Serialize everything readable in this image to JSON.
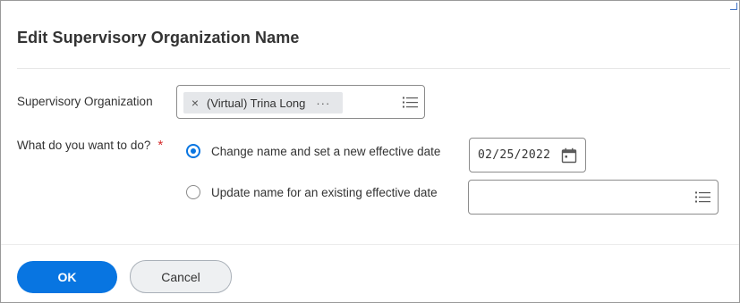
{
  "dialog": {
    "title": "Edit Supervisory Organization Name"
  },
  "supervisory_org": {
    "label": "Supervisory Organization",
    "selected_item": "(Virtual) Trina Long",
    "remove_glyph": "×",
    "more_glyph": "···",
    "remove_icon": "close-icon",
    "more_icon": "ellipsis-icon",
    "list_icon": "list-icon"
  },
  "action": {
    "label": "What do you want to do?",
    "required_marker": "*",
    "options": [
      {
        "label": "Change name and set a new effective date",
        "selected": true
      },
      {
        "label": "Update name for an existing effective date",
        "selected": false
      }
    ]
  },
  "effective_date": {
    "value": "02/25/2022",
    "icon": "calendar-icon"
  },
  "existing_date_select": {
    "value": "",
    "icon": "list-icon"
  },
  "footer": {
    "ok_label": "OK",
    "cancel_label": "Cancel"
  },
  "colors": {
    "primary": "#0875e1",
    "required": "#d42b2b",
    "text": "#333333",
    "border": "#8c8c8c",
    "pill_bg": "#e5e7ea",
    "cancel_bg": "#eef0f2"
  }
}
